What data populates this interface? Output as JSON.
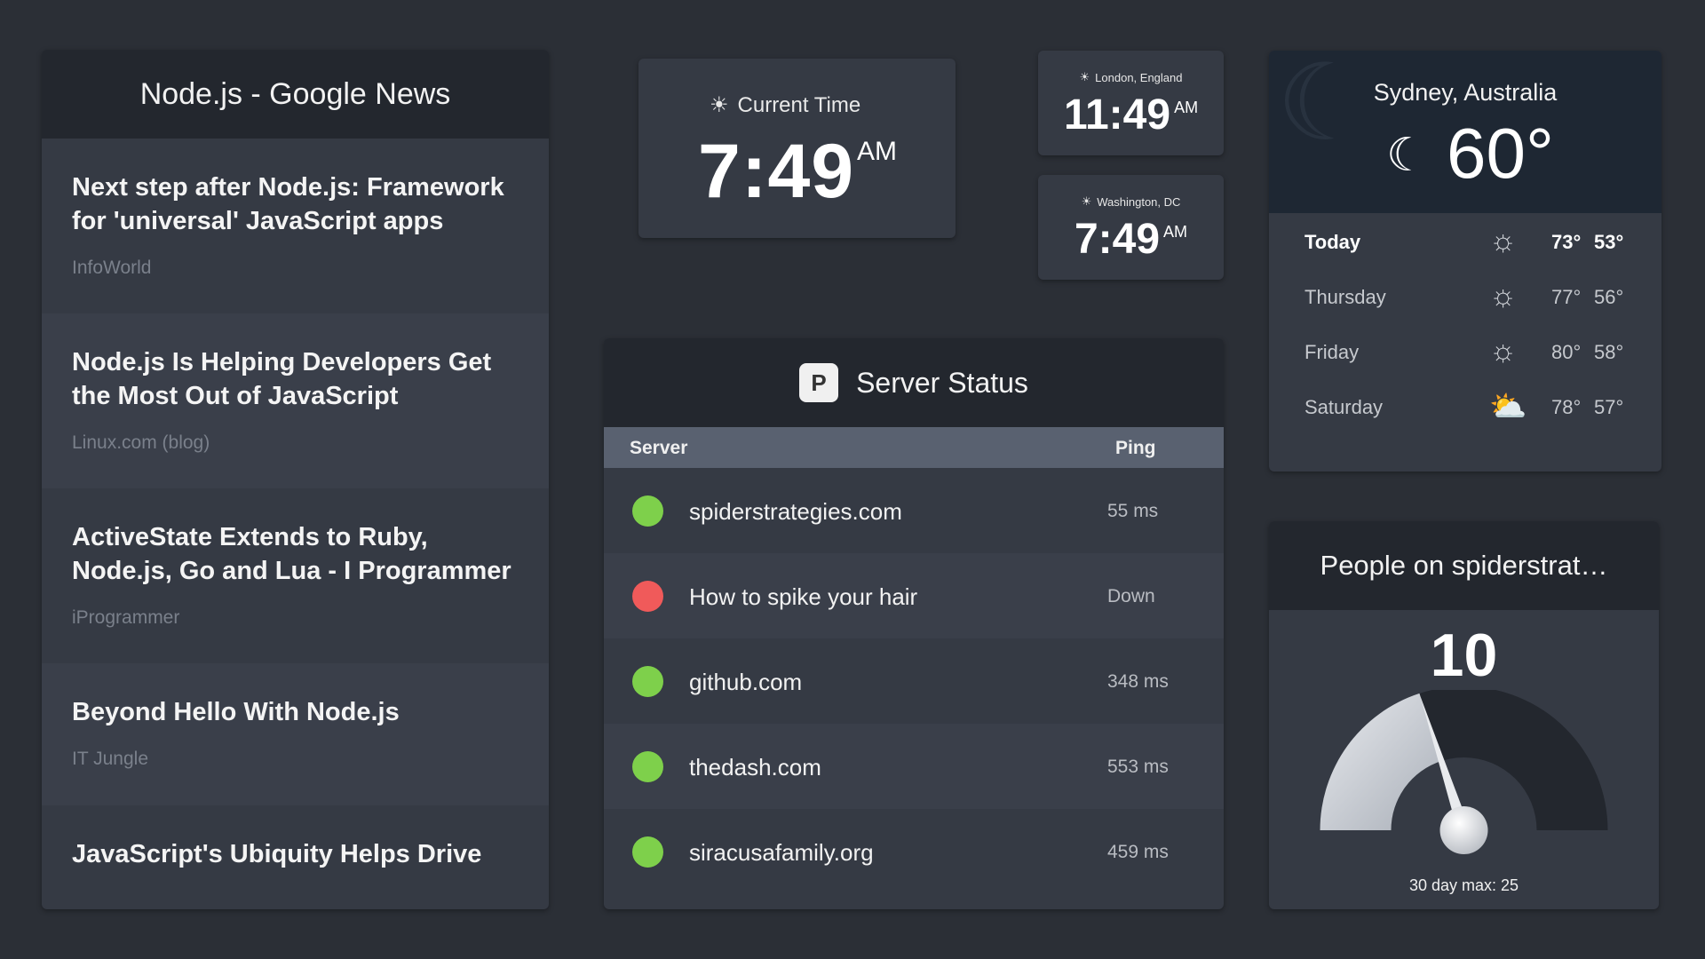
{
  "news": {
    "title": "Node.js - Google News",
    "items": [
      {
        "title": "Next step after Node.js: Framework for 'universal' JavaScript apps",
        "source": "InfoWorld"
      },
      {
        "title": "Node.js Is Helping Developers Get the Most Out of JavaScript",
        "source": "Linux.com (blog)"
      },
      {
        "title": "ActiveState Extends to Ruby, Node.js, Go and Lua - I Programmer",
        "source": "iProgrammer"
      },
      {
        "title": "Beyond Hello With Node.js",
        "source": "IT Jungle"
      },
      {
        "title": "JavaScript's Ubiquity Helps Drive",
        "source": ""
      }
    ]
  },
  "current_time": {
    "label": "Current Time",
    "time": "7:49",
    "ampm": "AM"
  },
  "clocks": [
    {
      "city": "London, England",
      "time": "11:49",
      "ampm": "AM"
    },
    {
      "city": "Washington, DC",
      "time": "7:49",
      "ampm": "AM"
    }
  ],
  "weather": {
    "city": "Sydney, Australia",
    "temp": "60°",
    "current_icon": "moon-stars-icon",
    "days": [
      {
        "day": "Today",
        "icon": "sun-icon",
        "hi": "73°",
        "lo": "53°"
      },
      {
        "day": "Thursday",
        "icon": "sun-icon",
        "hi": "77°",
        "lo": "56°"
      },
      {
        "day": "Friday",
        "icon": "sun-icon",
        "hi": "80°",
        "lo": "58°"
      },
      {
        "day": "Saturday",
        "icon": "cloud-sun-icon",
        "hi": "78°",
        "lo": "57°"
      }
    ]
  },
  "server_status": {
    "title": "Server Status",
    "logo_letter": "P",
    "col_server": "Server",
    "col_ping": "Ping",
    "rows": [
      {
        "name": "spiderstrategies.com",
        "ping": "55 ms",
        "status_color": "#7ed04b"
      },
      {
        "name": "How to spike your hair",
        "ping": "Down",
        "status_color": "#f05a5a"
      },
      {
        "name": "github.com",
        "ping": "348 ms",
        "status_color": "#7ed04b"
      },
      {
        "name": "thedash.com",
        "ping": "553 ms",
        "status_color": "#7ed04b"
      },
      {
        "name": "siracusafamily.org",
        "ping": "459 ms",
        "status_color": "#7ed04b"
      }
    ]
  },
  "people": {
    "title": "People on spiderstrat…",
    "count": "10",
    "max_label": "30 day max: 25",
    "value": 10,
    "max": 25
  }
}
